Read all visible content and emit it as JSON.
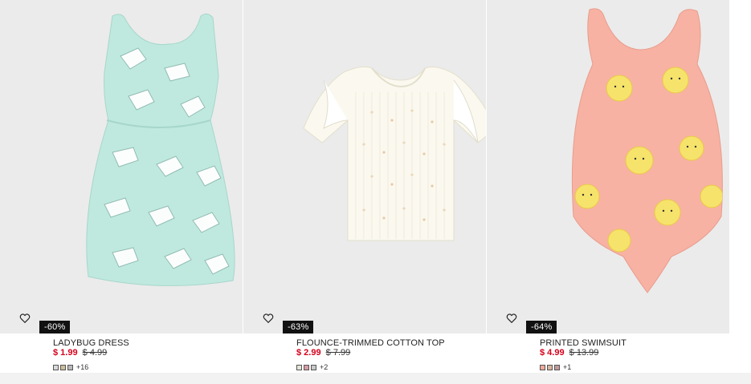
{
  "products": [
    {
      "name": "LADYBUG DRESS",
      "discount": "-60%",
      "sale_price": "$ 1.99",
      "original_price": "$ 4.99",
      "swatch_colors": [
        "#d9d9d9",
        "#cdbd9a",
        "#b9b9b9"
      ],
      "more_colors": "+16",
      "image_icon": "mint-dress-image",
      "favorite_icon": "heart-icon"
    },
    {
      "name": "FLOUNCE-TRIMMED COTTON TOP",
      "discount": "-63%",
      "sale_price": "$ 2.99",
      "original_price": "$ 7.99",
      "swatch_colors": [
        "#e8e4d8",
        "#d89aa8",
        "#c8c8c8"
      ],
      "more_colors": "+2",
      "image_icon": "cream-top-image",
      "favorite_icon": "heart-icon"
    },
    {
      "name": "PRINTED SWIMSUIT",
      "discount": "-64%",
      "sale_price": "$ 4.99",
      "original_price": "$ 13.99",
      "swatch_colors": [
        "#f3a99a",
        "#d7b7a0",
        "#c39a9a"
      ],
      "more_colors": "+1",
      "image_icon": "pink-swimsuit-image",
      "favorite_icon": "heart-icon"
    }
  ],
  "colors": {
    "sale_red": "#d6001c",
    "badge_black": "#111111",
    "image_bg": "#ebebeb"
  }
}
